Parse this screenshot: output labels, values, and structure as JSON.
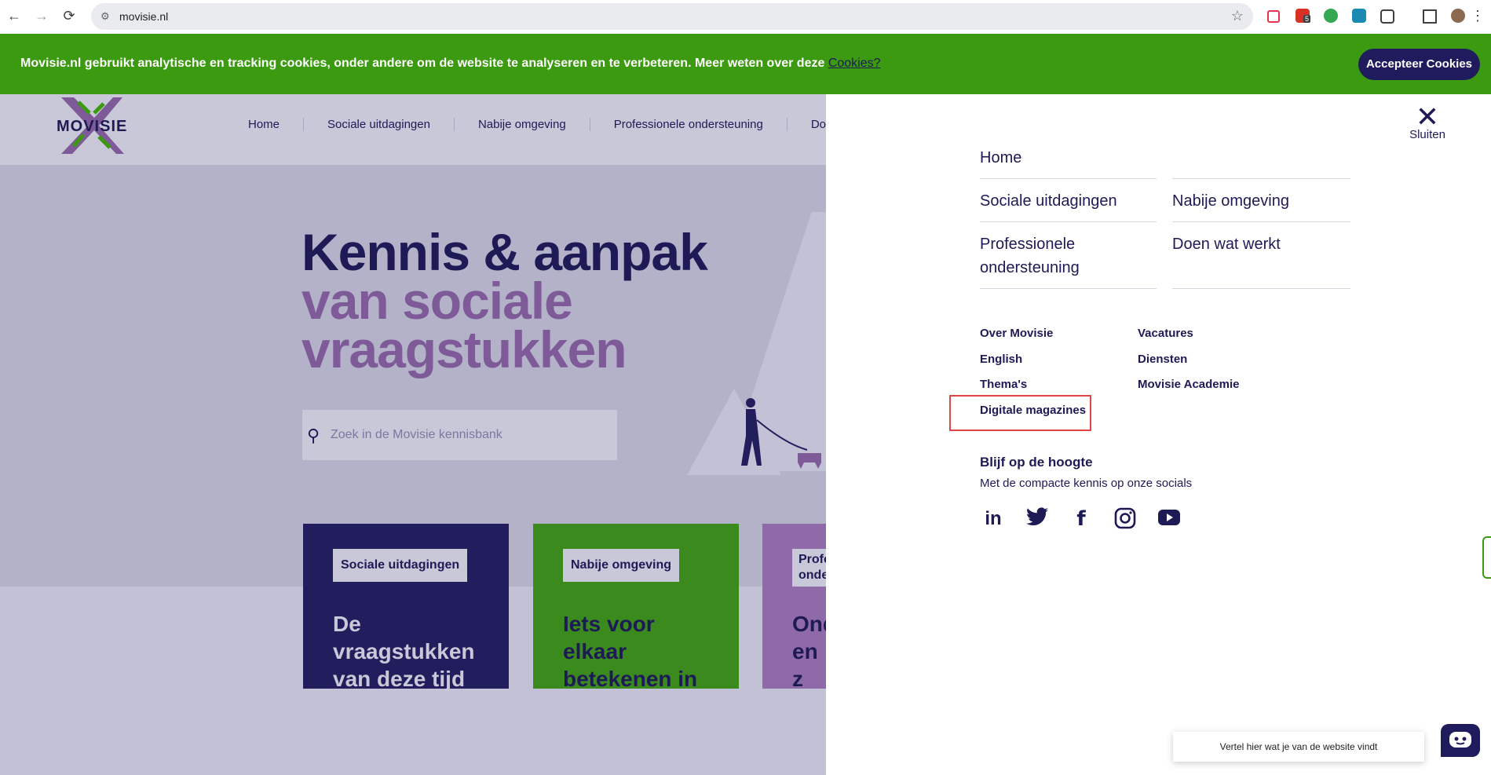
{
  "browser": {
    "url": "movisie.nl",
    "back_icon": "←",
    "forward_icon": "→",
    "reload_icon": "⟳",
    "site_icon": "⚙",
    "star_icon": "☆",
    "extension_badge": "5"
  },
  "cookie_bar": {
    "message": "Movisie.nl gebruikt analytische en tracking cookies, onder andere om de website te analyseren en te verbeteren. Meer weten over deze ",
    "link": "Cookies?",
    "accept_label": "Accepteer Cookies"
  },
  "site": {
    "logo_text": "MOVISIE",
    "nav": [
      "Home",
      "Sociale uitdagingen",
      "Nabije omgeving",
      "Professionele ondersteuning",
      "Doe"
    ],
    "hero": {
      "line1": "Kennis & aanpak",
      "line2": "van sociale",
      "line3": "vraagstukken"
    },
    "search_placeholder": "Zoek in de Movisie kennisbank",
    "cards": [
      {
        "tag": "Sociale uitdagingen",
        "text": "De vraagstukken van deze tijd",
        "bg": "#221d5c",
        "color": "#c9c8d9"
      },
      {
        "tag": "Nabije omgeving",
        "text": "Iets voor elkaar betekenen in",
        "bg": "#3a8a1e",
        "color": "#1e1a55"
      },
      {
        "tag": "Profe onde",
        "text": "Ond en z",
        "bg": "#8f6aa8",
        "color": "#1e1a55"
      }
    ]
  },
  "menu": {
    "close_label": "Sluiten",
    "primary": [
      {
        "label": "Home"
      },
      {
        "label": "Sociale uitdagingen"
      },
      {
        "label": "Nabije omgeving"
      },
      {
        "label": "Professionele ondersteuning"
      },
      {
        "label": "Doen wat werkt"
      }
    ],
    "secondary": [
      {
        "label": "Over Movisie"
      },
      {
        "label": "Vacatures"
      },
      {
        "label": "English"
      },
      {
        "label": "Diensten"
      },
      {
        "label": "Thema's"
      },
      {
        "label": "Movisie Academie"
      },
      {
        "label": "Digitale magazines"
      }
    ],
    "stay_title": "Blijf op de hoogte",
    "stay_text": "Met de compacte kennis op onze socials",
    "socials": [
      "linkedin-icon",
      "twitter-icon",
      "facebook-icon",
      "instagram-icon",
      "youtube-icon"
    ]
  },
  "feedback": {
    "text": "Vertel hier wat je van de website vindt"
  },
  "colors": {
    "brand_dark": "#1e1a55",
    "brand_green": "#3c9a10",
    "brand_purple": "#7e5a98",
    "highlight": "#e04545"
  }
}
